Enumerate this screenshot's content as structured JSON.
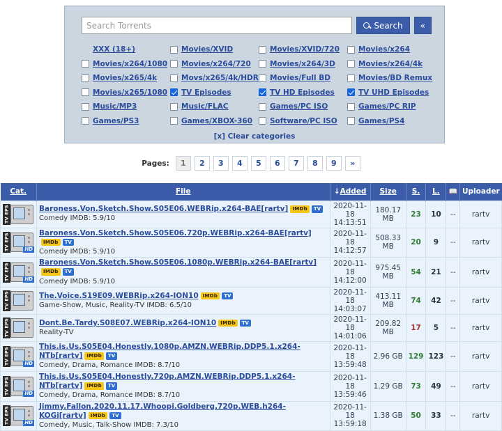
{
  "search": {
    "placeholder": "Search Torrents",
    "value": "",
    "search_label": "Search",
    "collapse_label": "«",
    "search_icon": "magnifier-icon"
  },
  "categories": {
    "clear_label": "[x] Clear categories",
    "items": [
      {
        "label": "XXX (18+)",
        "checked": false,
        "hide_checkbox": false
      },
      {
        "label": "Movies/XVID",
        "checked": false
      },
      {
        "label": "Movies/XVID/720",
        "checked": false
      },
      {
        "label": "Movies/x264",
        "checked": false
      },
      {
        "label": "Movies/x264/1080",
        "checked": false
      },
      {
        "label": "Movies/x264/720",
        "checked": false
      },
      {
        "label": "Movies/x264/3D",
        "checked": false
      },
      {
        "label": "Movies/x264/4k",
        "checked": false
      },
      {
        "label": "Movies/x265/4k",
        "checked": false
      },
      {
        "label": "Movs/x265/4k/HDR",
        "checked": false
      },
      {
        "label": "Movies/Full BD",
        "checked": false
      },
      {
        "label": "Movies/BD Remux",
        "checked": false
      },
      {
        "label": "Movies/x265/1080",
        "checked": false
      },
      {
        "label": "TV Episodes",
        "checked": true
      },
      {
        "label": "TV HD Episodes",
        "checked": true
      },
      {
        "label": "TV UHD Episodes",
        "checked": true
      },
      {
        "label": "Music/MP3",
        "checked": false
      },
      {
        "label": "Music/FLAC",
        "checked": false
      },
      {
        "label": "Games/PC ISO",
        "checked": false
      },
      {
        "label": "Games/PC RIP",
        "checked": false
      },
      {
        "label": "Games/PS3",
        "checked": false
      },
      {
        "label": "Games/XBOX-360",
        "checked": false
      },
      {
        "label": "Software/PC ISO",
        "checked": false
      },
      {
        "label": "Games/PS4",
        "checked": false
      }
    ]
  },
  "pager": {
    "label": "Pages:",
    "pages": [
      "1",
      "2",
      "3",
      "4",
      "5",
      "6",
      "7",
      "8",
      "9",
      "»"
    ],
    "current": "1"
  },
  "table": {
    "headers": {
      "cat": "Cat.",
      "file": "File",
      "added": "Added",
      "added_sort_arrow": "↓",
      "size": "Size",
      "seeders": "S.",
      "leechers": "L.",
      "comments_icon": "comments-book-icon",
      "uploader": "Uploader"
    },
    "rows": [
      {
        "cat_icon": "tv-eps-icon",
        "hd": false,
        "title": "Baroness.Von.Sketch.Show.S05E06.WEBRip.x264-BAE[rartv]",
        "badges": [
          "IMDb",
          "TV"
        ],
        "subtitle": "Comedy IMDB: 5.9/10",
        "added_date": "2020-11-18",
        "added_time": "14:13:51",
        "size": "180.17 MB",
        "seeders": "23",
        "seeders_low": false,
        "leechers": "10",
        "comments": "--",
        "uploader": "rartv"
      },
      {
        "cat_icon": "tv-eps-icon",
        "hd": true,
        "title": "Baroness.Von.Sketch.Show.S05E06.720p.WEBRip.x264-BAE[rartv]",
        "badges": [
          "IMDb",
          "TV"
        ],
        "subtitle": "Comedy IMDB: 5.9/10",
        "added_date": "2020-11-18",
        "added_time": "14:12:57",
        "size": "508.33 MB",
        "seeders": "20",
        "seeders_low": false,
        "leechers": "9",
        "comments": "--",
        "uploader": "rartv"
      },
      {
        "cat_icon": "tv-eps-icon",
        "hd": true,
        "title": "Baroness.Von.Sketch.Show.S05E06.1080p.WEBRip.x264-BAE[rartv]",
        "badges": [
          "IMDb",
          "TV"
        ],
        "subtitle": "Comedy IMDB: 5.9/10",
        "added_date": "2020-11-18",
        "added_time": "14:12:00",
        "size": "975.45 MB",
        "seeders": "54",
        "seeders_low": false,
        "leechers": "21",
        "comments": "--",
        "uploader": "rartv"
      },
      {
        "cat_icon": "tv-eps-icon",
        "hd": false,
        "title": "The.Voice.S19E09.WEBRip.x264-ION10",
        "badges": [
          "IMDb",
          "TV"
        ],
        "subtitle": "Game-Show, Music, Reality-TV IMDB: 6.5/10",
        "added_date": "2020-11-18",
        "added_time": "14:03:07",
        "size": "413.11 MB",
        "seeders": "74",
        "seeders_low": false,
        "leechers": "42",
        "comments": "--",
        "uploader": "rartv"
      },
      {
        "cat_icon": "tv-eps-icon",
        "hd": false,
        "title": "Dont.Be.Tardy.S08E07.WEBRip.x264-ION10",
        "badges": [
          "IMDb",
          "TV"
        ],
        "subtitle": "Reality-TV",
        "added_date": "2020-11-18",
        "added_time": "14:01:06",
        "size": "209.82 MB",
        "seeders": "17",
        "seeders_low": true,
        "leechers": "5",
        "comments": "--",
        "uploader": "rartv"
      },
      {
        "cat_icon": "tv-eps-icon",
        "hd": true,
        "title": "This.is.Us.S05E04.Honestly.1080p.AMZN.WEBRip.DDP5.1.x264-NTb[rartv]",
        "badges": [
          "IMDb",
          "TV"
        ],
        "subtitle": "Comedy, Drama, Romance IMDB: 8.7/10",
        "added_date": "2020-11-18",
        "added_time": "13:59:48",
        "size": "2.96 GB",
        "seeders": "129",
        "seeders_low": false,
        "leechers": "123",
        "comments": "--",
        "uploader": "rartv"
      },
      {
        "cat_icon": "tv-eps-icon",
        "hd": true,
        "title": "This.is.Us.S05E04.Honestly.720p.AMZN.WEBRip.DDP5.1.x264-NTb[rartv]",
        "badges": [
          "IMDb",
          "TV"
        ],
        "subtitle": "Comedy, Drama, Romance IMDB: 8.7/10",
        "added_date": "2020-11-18",
        "added_time": "13:59:46",
        "size": "1.29 GB",
        "seeders": "73",
        "seeders_low": false,
        "leechers": "49",
        "comments": "--",
        "uploader": "rartv"
      },
      {
        "cat_icon": "tv-eps-icon",
        "hd": true,
        "title": "Jimmy.Fallon.2020.11.17.Whoopi.Goldberg.720p.WEB.h264-KOGi[rartv]",
        "badges": [
          "IMDb",
          "TV"
        ],
        "subtitle": "Comedy, Music, Talk-Show IMDB: 7.3/10",
        "added_date": "2020-11-18",
        "added_time": "13:59:18",
        "size": "1.38 GB",
        "seeders": "50",
        "seeders_low": false,
        "leechers": "33",
        "comments": "--",
        "uploader": "rartv"
      }
    ]
  },
  "colors": {
    "panel_bg": "#ccd6e0",
    "accent_blue": "#3b5ca8",
    "link_blue": "#2a4c9b",
    "row_bg": "#eaf3fb",
    "seed_green": "#2e7d32",
    "seed_red": "#a03030",
    "imdb_yellow": "#f5c518"
  }
}
